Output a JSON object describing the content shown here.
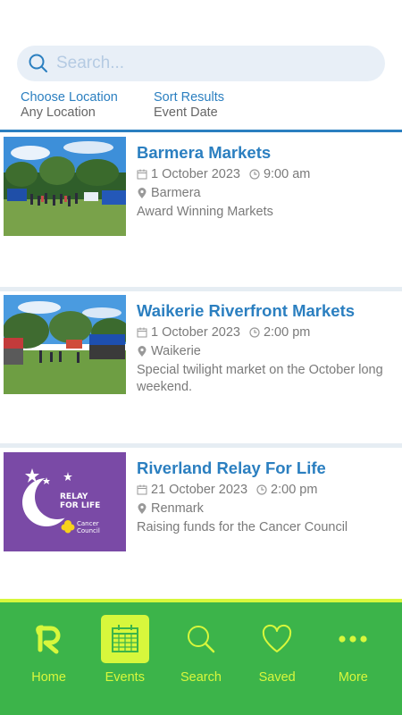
{
  "search": {
    "placeholder": "Search..."
  },
  "filters": {
    "location": {
      "label": "Choose Location",
      "value": "Any Location"
    },
    "sort": {
      "label": "Sort Results",
      "value": "Event Date"
    }
  },
  "events": [
    {
      "title": "Barmera Markets",
      "date": "1 October 2023",
      "time": "9:00 am",
      "location": "Barmera",
      "description": "Award Winning Markets"
    },
    {
      "title": "Waikerie Riverfront Markets",
      "date": "1 October 2023",
      "time": "2:00 pm",
      "location": "Waikerie",
      "description": "Special twilight market on the October long weekend."
    },
    {
      "title": "Riverland Relay For Life",
      "date": "21 October 2023",
      "time": "2:00 pm",
      "location": "Renmark",
      "description": "Raising funds for the Cancer Council",
      "logo_text": {
        "line1": "RELAY",
        "line2": "FOR LIFE",
        "line3": "Cancer",
        "line4": "Council"
      }
    }
  ],
  "nav": {
    "home": "Home",
    "events": "Events",
    "search": "Search",
    "saved": "Saved",
    "more": "More"
  },
  "colors": {
    "accent": "#2b7fc0",
    "nav_bg": "#3cb44a",
    "nav_fg": "#d7f73c",
    "relay_purple": "#7a4aa6"
  }
}
